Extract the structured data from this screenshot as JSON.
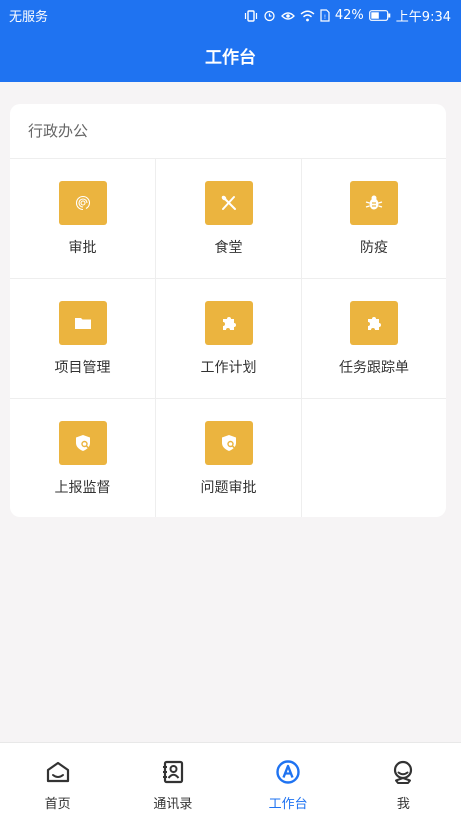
{
  "status_bar": {
    "carrier": "无服务",
    "battery": "42%",
    "time": "上午9:34"
  },
  "header": {
    "title": "工作台"
  },
  "section": {
    "title": "行政办公",
    "items": [
      {
        "label": "审批",
        "icon": "fingerprint-icon"
      },
      {
        "label": "食堂",
        "icon": "utensils-icon"
      },
      {
        "label": "防疫",
        "icon": "bug-icon"
      },
      {
        "label": "项目管理",
        "icon": "folder-icon"
      },
      {
        "label": "工作计划",
        "icon": "puzzle-icon"
      },
      {
        "label": "任务跟踪单",
        "icon": "puzzle-icon"
      },
      {
        "label": "上报监督",
        "icon": "shield-search-icon"
      },
      {
        "label": "问题审批",
        "icon": "shield-search-icon"
      }
    ]
  },
  "tabbar": {
    "items": [
      {
        "label": "首页",
        "icon": "home-icon"
      },
      {
        "label": "通讯录",
        "icon": "contacts-icon"
      },
      {
        "label": "工作台",
        "icon": "workbench-icon",
        "active": true
      },
      {
        "label": "我",
        "icon": "profile-icon"
      }
    ]
  },
  "colors": {
    "brand": "#1f73f1",
    "tile": "#ebb43f"
  }
}
